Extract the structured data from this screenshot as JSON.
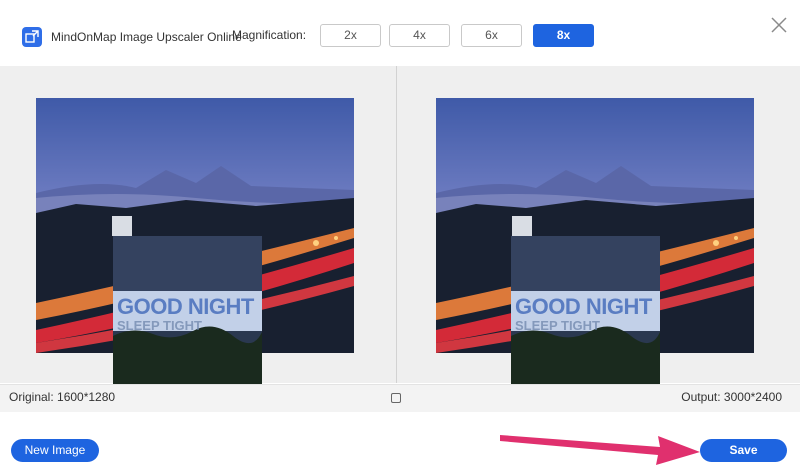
{
  "header": {
    "app_title": "MindOnMap Image Upscaler Online",
    "magnification_label": "Magnification:",
    "magnification_options": [
      "2x",
      "4x",
      "6x",
      "8x"
    ],
    "selected": "8x",
    "logo_icon": "image-upscale-icon",
    "close_icon": "close-icon"
  },
  "preview": {
    "original_label": "Original: 1600*1280",
    "output_label": "Output: 3000*2400",
    "overlay_text": "GOOD NIGHT",
    "overlay_subtext": "SLEEP TIGHT",
    "compare_icon": "compare-icon"
  },
  "footer": {
    "new_image_label": "New Image",
    "save_label": "Save"
  },
  "colors": {
    "accent": "#1e64e0",
    "arrow": "#e0306e"
  }
}
